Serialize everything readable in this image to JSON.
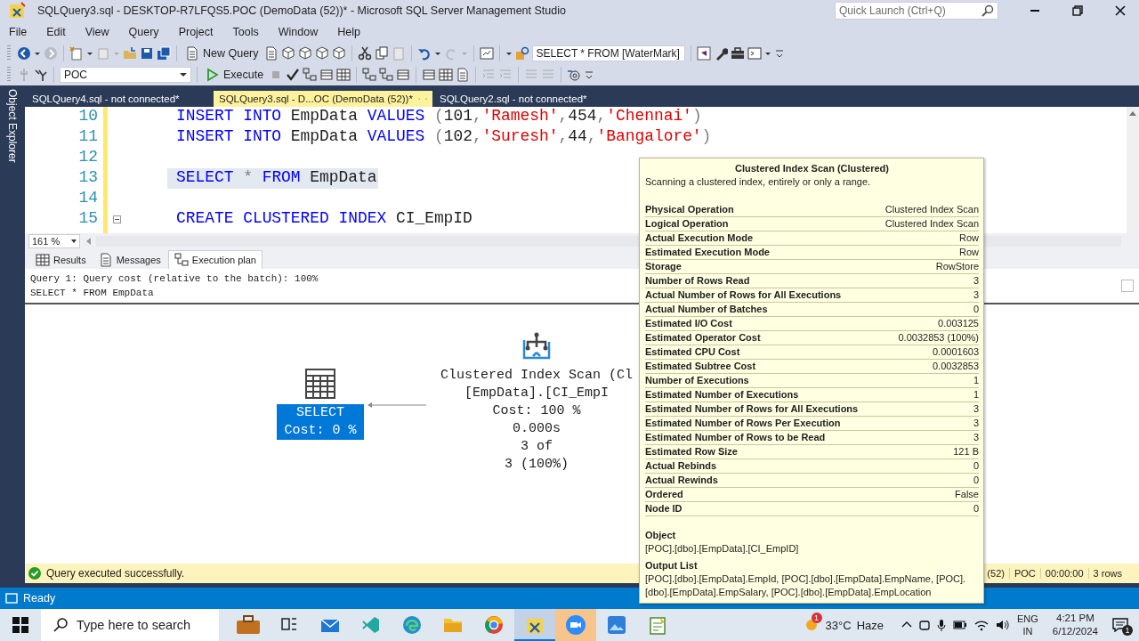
{
  "window": {
    "title": "SQLQuery3.sql - DESKTOP-R7LFQS5.POC (DemoData (52))* - Microsoft SQL Server Management Studio"
  },
  "quick_launch": {
    "placeholder": "Quick Launch (Ctrl+Q)"
  },
  "menu": [
    "File",
    "Edit",
    "View",
    "Query",
    "Project",
    "Tools",
    "Window",
    "Help"
  ],
  "toolbar": {
    "new_query": "New Query",
    "query_combo": "SELECT * FROM [WaterMark]",
    "database_combo": "POC",
    "execute": "Execute"
  },
  "side_panel": {
    "label": "Object Explorer"
  },
  "document_tabs": [
    {
      "label": "SQLQuery4.sql - not connected*",
      "selected": false
    },
    {
      "label": "SQLQuery3.sql - D...OC (DemoData (52))*",
      "selected": true
    },
    {
      "label": "SQLQuery2.sql - not connected*",
      "selected": false
    }
  ],
  "editor": {
    "zoom": "161 %",
    "lines": [
      {
        "number": "10",
        "kind": "plain",
        "highlighted": false,
        "tokens": [
          {
            "text": "INSERT INTO",
            "kind": "keyword"
          },
          {
            "text": " EmpData ",
            "kind": "plain"
          },
          {
            "text": "VALUES",
            "kind": "keyword"
          },
          {
            "text": " (",
            "kind": "operator"
          },
          {
            "text": "101",
            "kind": "plain"
          },
          {
            "text": ",",
            "kind": "operator"
          },
          {
            "text": "'Ramesh'",
            "kind": "string"
          },
          {
            "text": ",",
            "kind": "operator"
          },
          {
            "text": "454",
            "kind": "plain"
          },
          {
            "text": ",",
            "kind": "operator"
          },
          {
            "text": "'Chennai'",
            "kind": "string"
          },
          {
            "text": ")",
            "kind": "operator"
          }
        ]
      },
      {
        "number": "11",
        "kind": "plain",
        "highlighted": false,
        "tokens": [
          {
            "text": "INSERT INTO",
            "kind": "keyword"
          },
          {
            "text": " EmpData ",
            "kind": "plain"
          },
          {
            "text": "VALUES",
            "kind": "keyword"
          },
          {
            "text": " (",
            "kind": "operator"
          },
          {
            "text": "102",
            "kind": "plain"
          },
          {
            "text": ",",
            "kind": "operator"
          },
          {
            "text": "'Suresh'",
            "kind": "string"
          },
          {
            "text": ",",
            "kind": "operator"
          },
          {
            "text": "44",
            "kind": "plain"
          },
          {
            "text": ",",
            "kind": "operator"
          },
          {
            "text": "'Bangalore'",
            "kind": "string"
          },
          {
            "text": ")",
            "kind": "operator"
          }
        ]
      },
      {
        "number": "12",
        "kind": "plain",
        "highlighted": false
      },
      {
        "number": "13",
        "kind": "plain",
        "highlighted": true,
        "tokens": [
          {
            "text": "SELECT",
            "kind": "keyword"
          },
          {
            "text": " * ",
            "kind": "operator"
          },
          {
            "text": "FROM",
            "kind": "keyword"
          },
          {
            "text": " EmpData",
            "kind": "plain"
          }
        ]
      },
      {
        "number": "14",
        "kind": "plain",
        "highlighted": false
      },
      {
        "number": "15",
        "kind": "fold",
        "highlighted": false,
        "tokens": [
          {
            "text": "CREATE CLUSTERED INDEX",
            "kind": "keyword"
          },
          {
            "text": " CI_EmpID",
            "kind": "plain"
          }
        ]
      }
    ]
  },
  "results_tabs": [
    {
      "label": "Results",
      "selected": false
    },
    {
      "label": "Messages",
      "selected": false
    },
    {
      "label": "Execution plan",
      "selected": true
    }
  ],
  "plan": {
    "header": [
      "Query 1: Query cost (relative to the batch): 100%",
      "SELECT * FROM EmpData"
    ],
    "nodes": [
      {
        "kind": "select",
        "selected": true,
        "lines": [
          "SELECT",
          "Cost: 0 %"
        ]
      },
      {
        "kind": "index_scan",
        "selected": false,
        "lines": [
          "Clustered Index Scan (Cl",
          "[EmpData].[CI_EmpI",
          "Cost: 100 %",
          "0.000s",
          "3 of",
          "3 (100%)"
        ]
      }
    ]
  },
  "tooltip": {
    "title": "Clustered Index Scan (Clustered)",
    "description": "Scanning a clustered index, entirely or only a range.",
    "properties": [
      {
        "label": "Physical Operation",
        "value": "Clustered Index Scan"
      },
      {
        "label": "Logical Operation",
        "value": "Clustered Index Scan"
      },
      {
        "label": "Actual Execution Mode",
        "value": "Row"
      },
      {
        "label": "Estimated Execution Mode",
        "value": "Row"
      },
      {
        "label": "Storage",
        "value": "RowStore"
      },
      {
        "label": "Number of Rows Read",
        "value": "3"
      },
      {
        "label": "Actual Number of Rows for All Executions",
        "value": "3"
      },
      {
        "label": "Actual Number of Batches",
        "value": "0"
      },
      {
        "label": "Estimated I/O Cost",
        "value": "0.003125"
      },
      {
        "label": "Estimated Operator Cost",
        "value": "0.0032853 (100%)"
      },
      {
        "label": "Estimated CPU Cost",
        "value": "0.0001603"
      },
      {
        "label": "Estimated Subtree Cost",
        "value": "0.0032853"
      },
      {
        "label": "Number of Executions",
        "value": "1"
      },
      {
        "label": "Estimated Number of Executions",
        "value": "1"
      },
      {
        "label": "Estimated Number of Rows for All Executions",
        "value": "3"
      },
      {
        "label": "Estimated Number of Rows Per Execution",
        "value": "3"
      },
      {
        "label": "Estimated Number of Rows to be Read",
        "value": "3"
      },
      {
        "label": "Estimated Row Size",
        "value": "121 B"
      },
      {
        "label": "Actual Rebinds",
        "value": "0"
      },
      {
        "label": "Actual Rewinds",
        "value": "0"
      },
      {
        "label": "Ordered",
        "value": "False"
      },
      {
        "label": "Node ID",
        "value": "0"
      }
    ],
    "sections": [
      {
        "heading": "Object",
        "text": "[POC].[dbo].[EmpData].[CI_EmpID]"
      },
      {
        "heading": "Output List",
        "text": "[POC].[dbo].[EmpData].EmpId, [POC].[dbo].[EmpData].EmpName, [POC].[dbo].[EmpData].EmpSalary, [POC].[dbo].[EmpData].EmpLocation"
      }
    ]
  },
  "status_bar": {
    "message": "Query executed successfully.",
    "items": [
      "(52)",
      "POC",
      "00:00:00",
      "3 rows"
    ]
  },
  "ready_bar": {
    "text": "Ready"
  },
  "taskbar": {
    "search": {
      "placeholder": "Type here to search"
    },
    "apps": [
      {
        "selected": false,
        "flashing": false
      },
      {
        "selected": false,
        "flashing": false
      },
      {
        "selected": false,
        "flashing": false
      },
      {
        "selected": false,
        "flashing": false
      },
      {
        "selected": false,
        "flashing": false
      },
      {
        "selected": false,
        "flashing": false
      },
      {
        "selected": false,
        "flashing": false
      },
      {
        "selected": true,
        "flashing": false
      },
      {
        "selected": false,
        "flashing": true
      },
      {
        "selected": false,
        "flashing": false
      },
      {
        "selected": false,
        "flashing": false
      }
    ],
    "weather": {
      "badge": "1",
      "temperature": "33°C",
      "condition": "Haze"
    },
    "language": "ENG",
    "region": "IN",
    "time": "4:21 PM",
    "date": "6/12/2024",
    "notifications": "1"
  }
}
